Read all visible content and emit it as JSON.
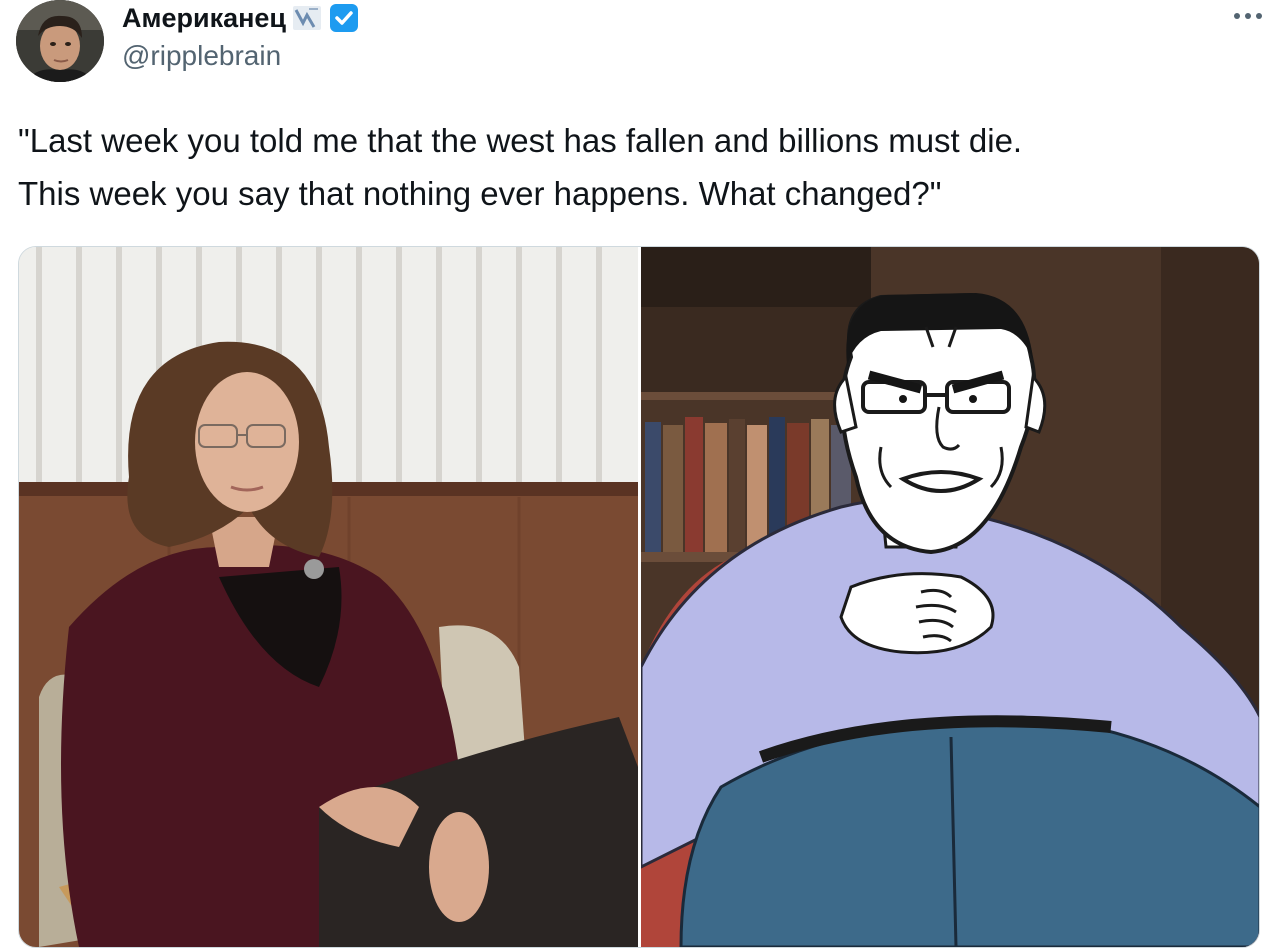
{
  "author": {
    "display_name": "Американец",
    "handle": "@ripplebrain",
    "flag_icon": "flag-badge-icon",
    "verified_icon": "verified-badge-icon",
    "verified_color": "#1d9bf0"
  },
  "tweet": {
    "text": "\"Last week you told me that the west has fallen and billions must die.\nThis week you say that nothing ever happens. What changed?\""
  },
  "menu": {
    "icon": "more-horizontal-icon"
  },
  "media": {
    "count": 2,
    "images": [
      {
        "icon": "photo-woman-therapist"
      },
      {
        "icon": "photo-wojak-cartoon-patient"
      }
    ]
  },
  "colors": {
    "text_primary": "#0f1419",
    "text_secondary": "#536471",
    "border": "#cfd9de"
  }
}
